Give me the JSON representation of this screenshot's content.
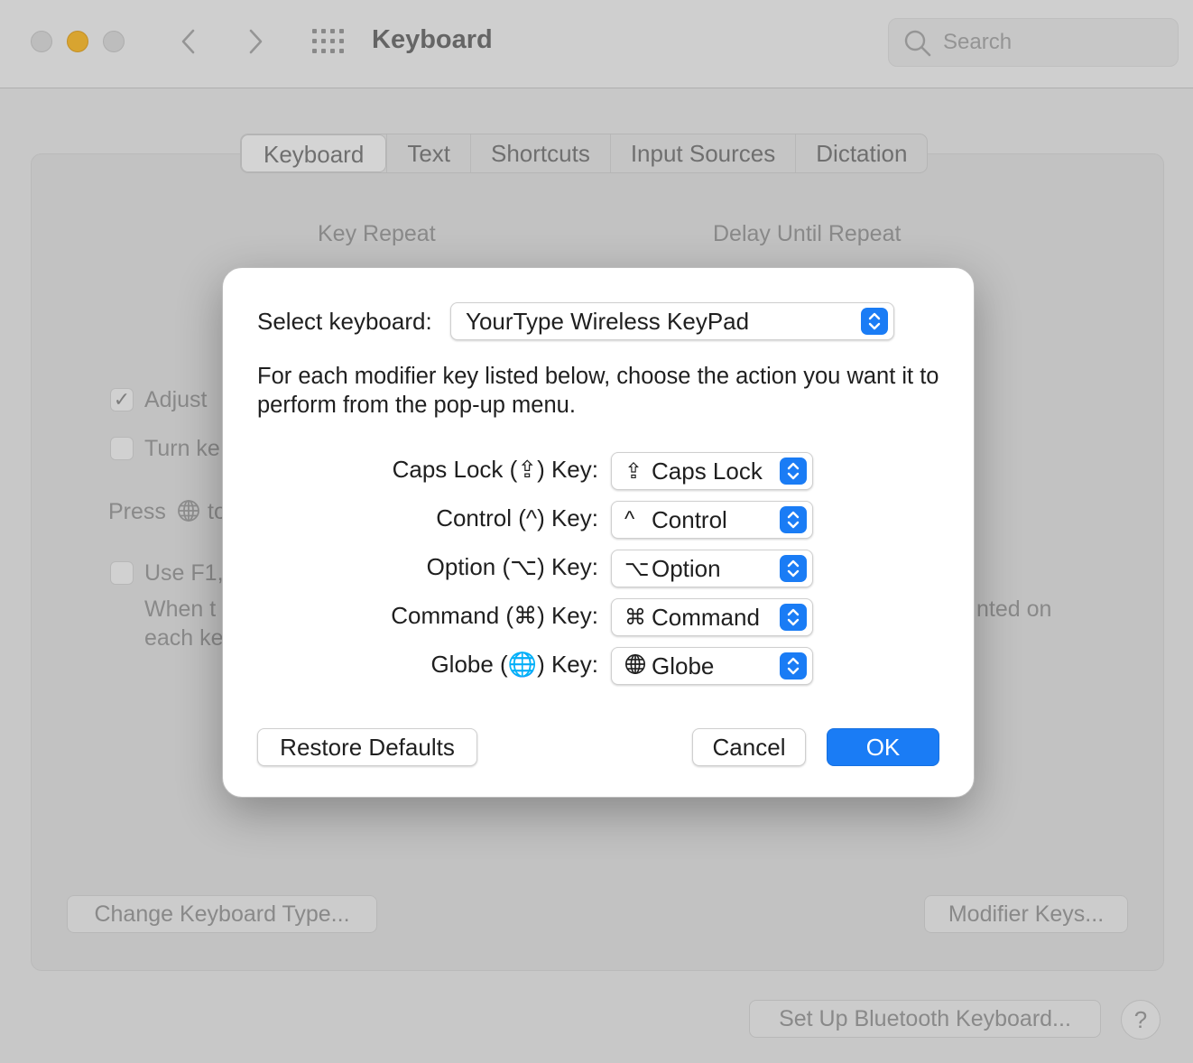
{
  "window": {
    "title": "Keyboard",
    "search_placeholder": "Search"
  },
  "tabs": [
    "Keyboard",
    "Text",
    "Shortcuts",
    "Input Sources",
    "Dictation"
  ],
  "background": {
    "key_repeat_label": "Key Repeat",
    "delay_label": "Delay Until Repeat",
    "adjust_label": "Adjust",
    "turn_label": "Turn ke",
    "press_label": "Press",
    "press_suffix": "to",
    "usef_label": "Use F1,",
    "when_label": "When t",
    "each_label": "each ke",
    "printed_fragment": "nted on",
    "change_type_button": "Change Keyboard Type...",
    "modifier_keys_button": "Modifier Keys...",
    "bluetooth_button": "Set Up Bluetooth Keyboard...",
    "help_button": "?"
  },
  "dialog": {
    "select_label": "Select keyboard:",
    "selected_keyboard": "YourType Wireless KeyPad",
    "description": "For each modifier key listed below, choose the action you want it to perform from the pop-up menu.",
    "modifiers": [
      {
        "label": "Caps Lock (⇪) Key:",
        "glyph": "⇪",
        "value": "Caps Lock"
      },
      {
        "label": "Control (^) Key:",
        "glyph": "^",
        "value": "Control"
      },
      {
        "label": "Option (⌥) Key:",
        "glyph": "⌥",
        "value": "Option"
      },
      {
        "label": "Command (⌘) Key:",
        "glyph": "⌘",
        "value": "Command"
      },
      {
        "label": "Globe (🌐) Key:",
        "glyph": "globe-icon",
        "value": "Globe"
      }
    ],
    "restore_button": "Restore Defaults",
    "cancel_button": "Cancel",
    "ok_button": "OK"
  },
  "colors": {
    "accent": "#1a7cf5",
    "minimize": "#fbbb2e"
  }
}
